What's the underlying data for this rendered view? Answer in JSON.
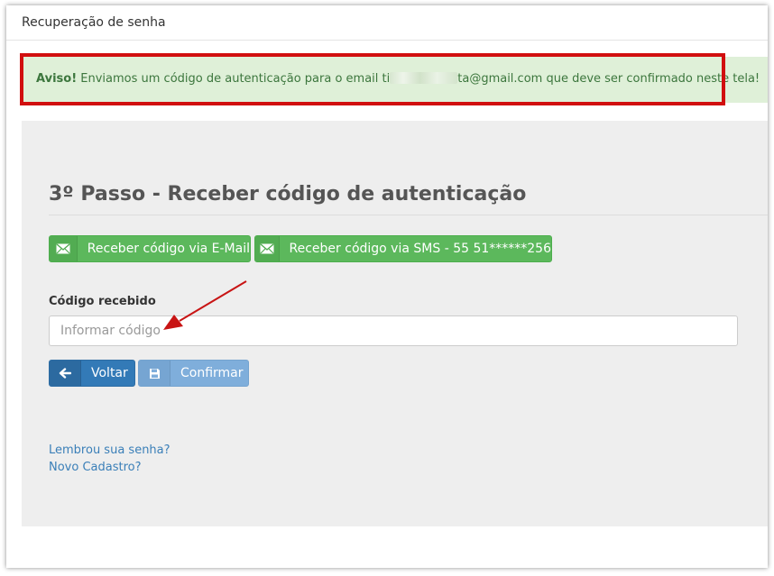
{
  "panel": {
    "title": "Recuperação de senha"
  },
  "alert": {
    "strong": "Aviso!",
    "text_before": " Enviamos um código de autenticação para o email ti",
    "text_after": "ta@gmail.com que deve ser confirmado neste tela!"
  },
  "step": {
    "title": "3º Passo - Receber código de autenticação"
  },
  "buttons": {
    "email": {
      "label": "Receber código via E-Mail",
      "icon": "envelope-icon"
    },
    "sms": {
      "label": "Receber código via SMS - 55 51******256",
      "icon": "envelope-icon"
    },
    "back": {
      "label": "Voltar",
      "icon": "arrow-left-icon"
    },
    "confirm": {
      "label": "Confirmar",
      "icon": "floppy-disk-icon"
    }
  },
  "form": {
    "code_label": "Código recebido",
    "code_placeholder": "Informar código",
    "code_value": ""
  },
  "links": {
    "remember": "Lembrou sua senha?",
    "register": "Novo Cadastro?"
  },
  "colors": {
    "alert_bg": "#dff0d8",
    "alert_text": "#3c763d",
    "highlight_red": "#d10f0f",
    "success_green": "#5cb85c",
    "primary_blue": "#337ab7",
    "link_blue": "#3a7fb8"
  }
}
